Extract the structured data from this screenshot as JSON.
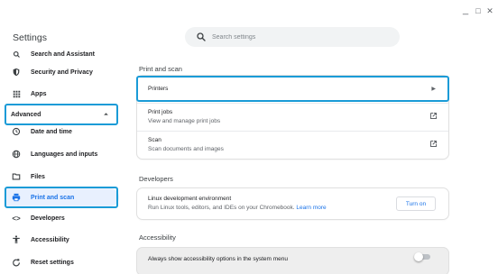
{
  "window": {
    "minimize": "_",
    "maximize": "□",
    "close": "✕"
  },
  "header": {
    "title": "Settings",
    "search_placeholder": "Search settings"
  },
  "sidebar": {
    "items": [
      {
        "label": "Search and Assistant",
        "icon": "search-icon"
      },
      {
        "label": "Security and Privacy",
        "icon": "shield-icon"
      },
      {
        "label": "Apps",
        "icon": "apps-grid-icon"
      },
      {
        "label": "Advanced",
        "icon": "chevron-up-icon"
      },
      {
        "label": "Date and time",
        "icon": "clock-icon"
      },
      {
        "label": "Languages and inputs",
        "icon": "globe-icon"
      },
      {
        "label": "Files",
        "icon": "folder-icon"
      },
      {
        "label": "Print and scan",
        "icon": "printer-icon",
        "selected": true
      },
      {
        "label": "Developers",
        "icon": "code-icon"
      },
      {
        "label": "Accessibility",
        "icon": "accessibility-icon"
      },
      {
        "label": "Reset settings",
        "icon": "reset-icon"
      }
    ]
  },
  "main": {
    "print_scan": {
      "title": "Print and scan",
      "printers": "Printers",
      "print_jobs_title": "Print jobs",
      "print_jobs_sub": "View and manage print jobs",
      "scan_title": "Scan",
      "scan_sub": "Scan documents and images"
    },
    "developers": {
      "title": "Developers",
      "linux_title": "Linux development environment",
      "linux_sub": "Run Linux tools, editors, and IDEs on your Chromebook.",
      "learn_more": "Learn more",
      "turn_on": "Turn on"
    },
    "accessibility": {
      "title": "Accessibility",
      "always_show": "Always show accessibility options in the system menu",
      "always_show_enabled": false
    }
  },
  "colors": {
    "accent": "#1a73e8",
    "highlight": "#1a9bd7",
    "selected_bg": "#e8f0fe"
  }
}
